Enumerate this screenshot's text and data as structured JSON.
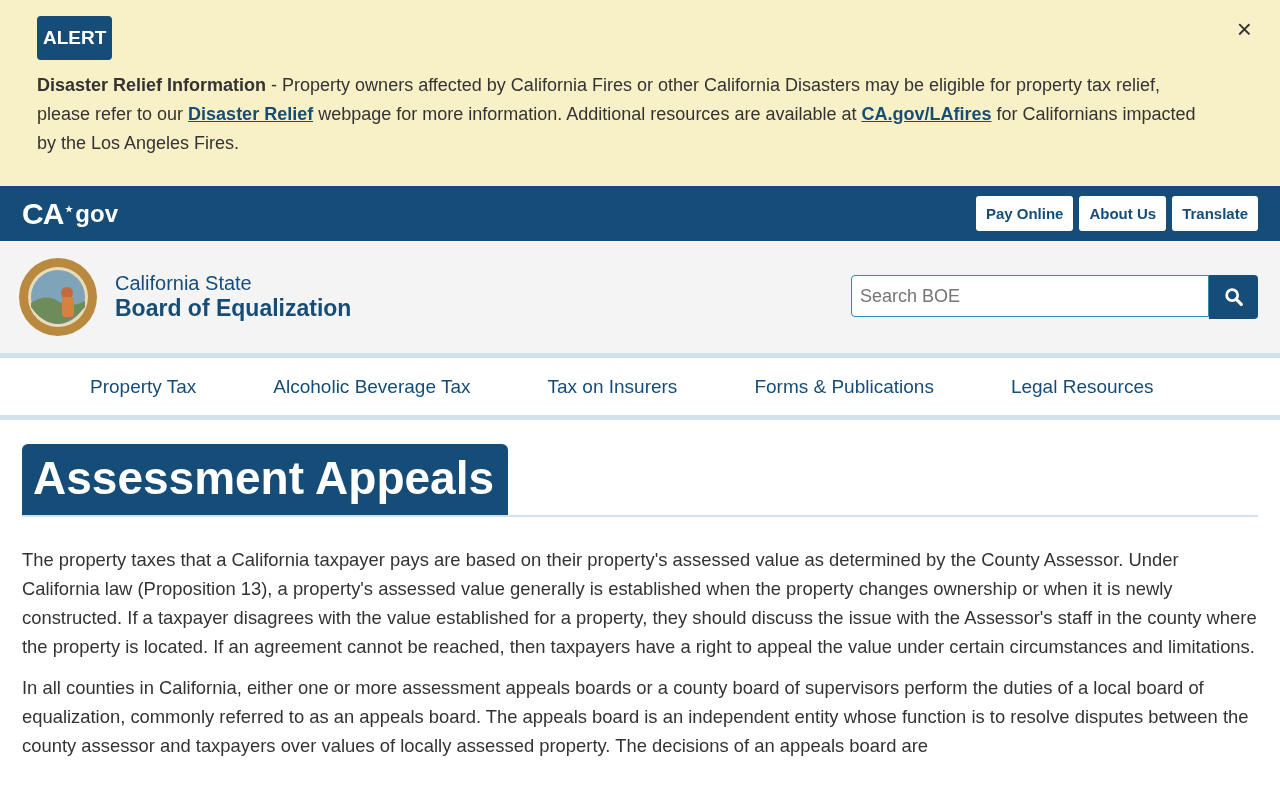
{
  "alert": {
    "badge": "ALERT",
    "title": "Disaster Relief Information",
    "separator": "-",
    "text": "Property owners affected by California Fires or other California Disasters may be eligible for property tax relief, please refer to our",
    "link1": "Disaster Relief",
    "text2": "webpage for more information. Additional resources are available at",
    "link2": "CA.gov/LAfires",
    "text3": "for Californians impacted by the Los Angeles Fires.",
    "close": "×"
  },
  "topbar": {
    "logo_ca": "CA",
    "logo_gov": "gov",
    "buttons": [
      "Pay Online",
      "About Us",
      "Translate"
    ]
  },
  "header": {
    "line1": "California State",
    "line2": "Board of Equalization",
    "search": {
      "placeholder": "Search BOE"
    }
  },
  "nav": [
    {
      "label": "Property Tax"
    },
    {
      "label": "Alcoholic Beverage Tax"
    },
    {
      "label": "Tax on Insurers"
    },
    {
      "label": "Forms & Publications"
    },
    {
      "label": "Legal Resources"
    }
  ],
  "page": {
    "title": "Assessment Appeals",
    "paragraphs": [
      "The property taxes that a California taxpayer pays are based on their property's assessed value as determined by the County Assessor. Under California law (Proposition 13), a property's assessed value generally is established when the property changes ownership or when it is newly constructed. If a taxpayer disagrees with the value established for a property, they should discuss the issue with the Assessor's staff in the county where the property is located. If an agreement cannot be reached, then taxpayers have a right to appeal the value under certain circumstances and limitations.",
      "In all counties in California, either one or more assessment appeals boards or a county board of supervisors perform the duties of a local board of equalization, commonly referred to as an appeals board. The appeals board is an independent entity whose function is to resolve disputes between the county assessor and taxpayers over values of locally assessed property. The decisions of an appeals board are"
    ]
  }
}
